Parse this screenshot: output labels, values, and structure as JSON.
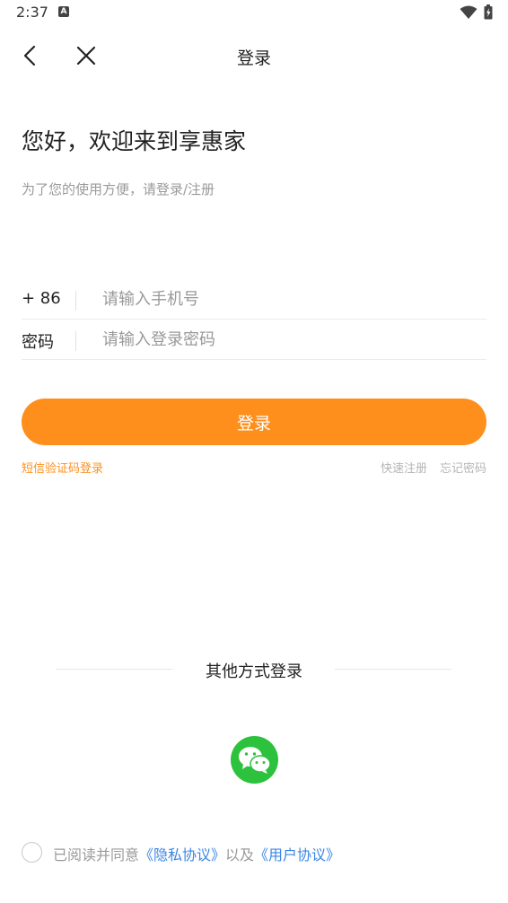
{
  "status_bar": {
    "time": "2:37",
    "notification_icon": "A"
  },
  "top_bar": {
    "title": "登录",
    "back_icon": "chevron-left-icon",
    "close_icon": "close-icon"
  },
  "greeting": "您好，欢迎来到享惠家",
  "subtitle": "为了您的使用方便，请登录/注册",
  "phone_field": {
    "label": "+ 86",
    "placeholder": "请输入手机号",
    "value": ""
  },
  "password_field": {
    "label": "密码",
    "placeholder": "请输入登录密码",
    "value": ""
  },
  "login_button": "登录",
  "links": {
    "sms_login": "短信验证码登录",
    "quick_register": "快速注册",
    "forgot_password": "忘记密码"
  },
  "other_login": {
    "title": "其他方式登录",
    "wechat_icon": "wechat-icon"
  },
  "agreement": {
    "prefix": "已阅读并同意",
    "privacy": "《隐私协议》",
    "middle": "以及",
    "user": "《用户协议》",
    "checked": false
  },
  "colors": {
    "accent": "#fe8f1d",
    "link": "#3b86e6",
    "wechat": "#2dc23d"
  }
}
